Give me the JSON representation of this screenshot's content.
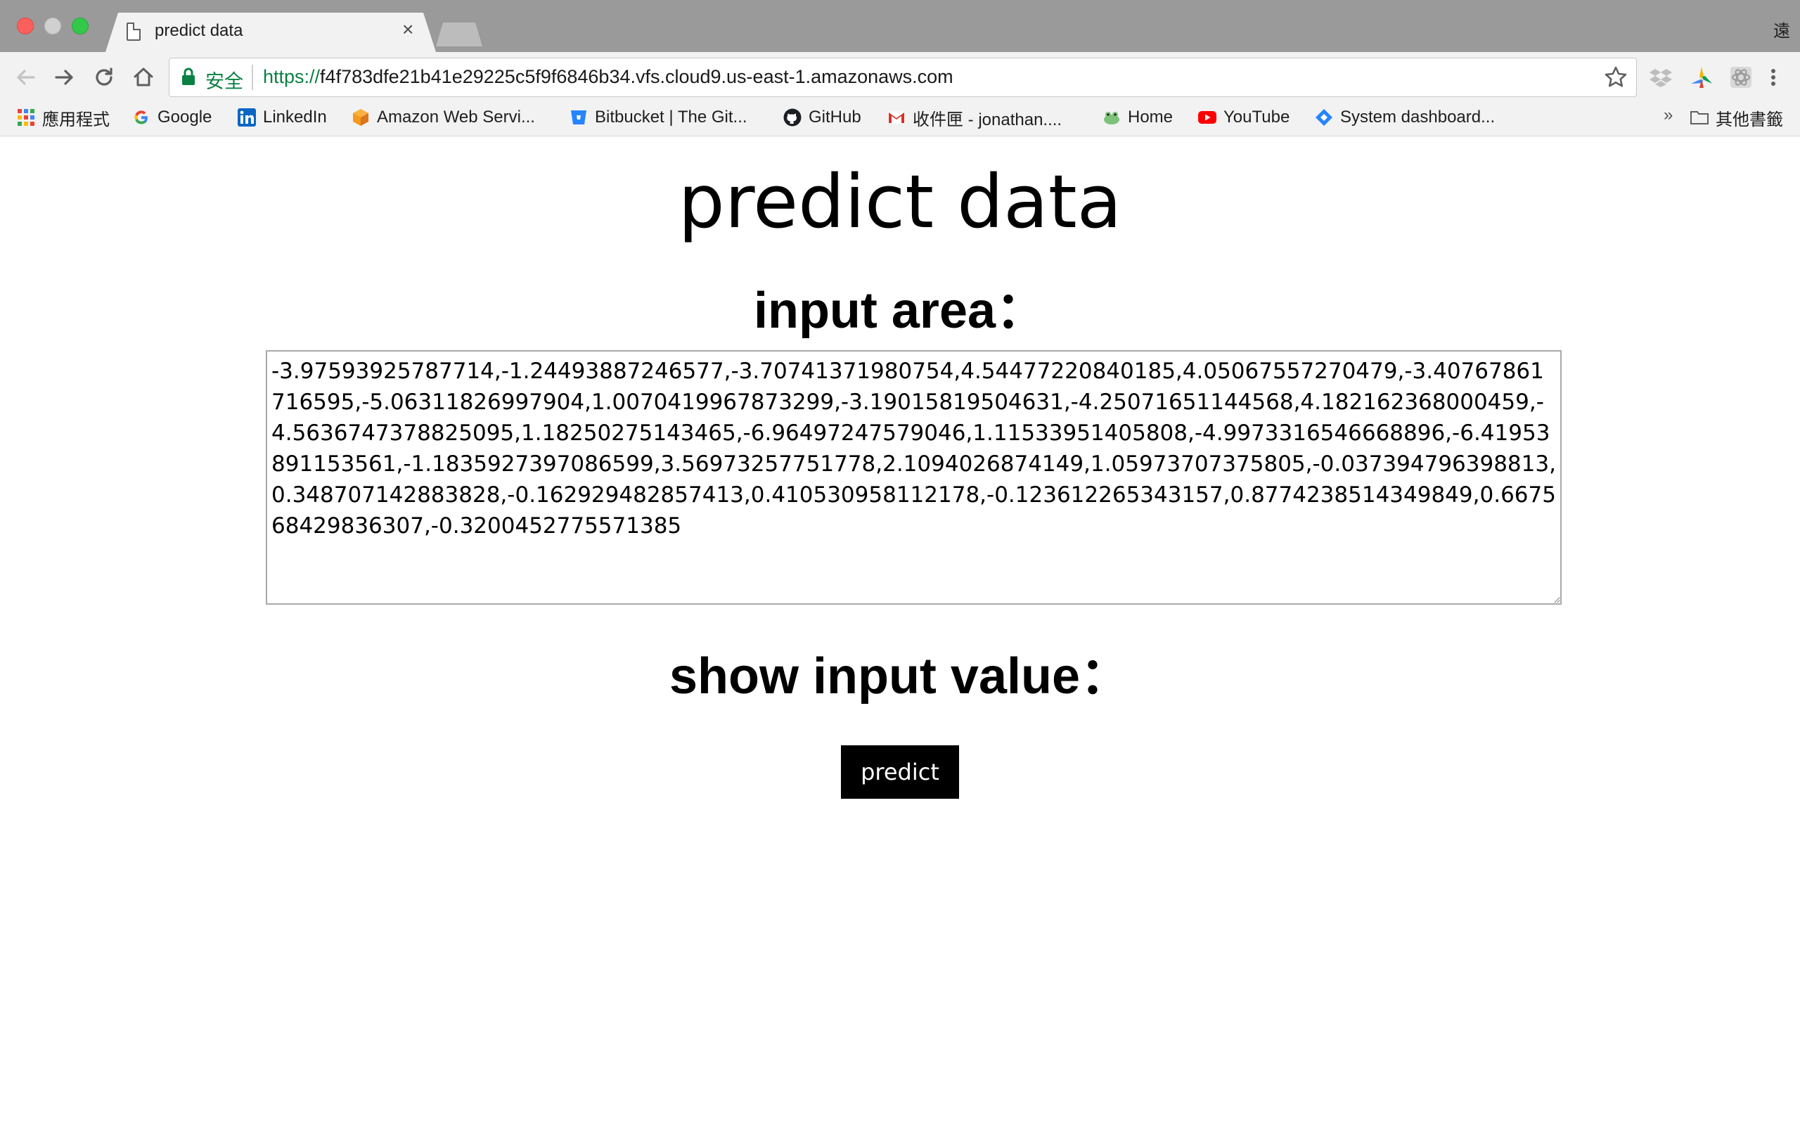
{
  "browser": {
    "tab_title": "predict data",
    "tab_close_glyph": "×",
    "profile_char": "遠",
    "secure_label": "安全",
    "url_scheme": "https://",
    "url_rest": "f4f783dfe21b41e29225c5f9f6846b34.vfs.cloud9.us-east-1.amazonaws.com",
    "bookmarks": [
      {
        "label": "應用程式",
        "icon": "apps-grid-icon"
      },
      {
        "label": "Google",
        "icon": "google-icon"
      },
      {
        "label": "LinkedIn",
        "icon": "linkedin-icon"
      },
      {
        "label": "Amazon Web Servi...",
        "icon": "aws-icon"
      },
      {
        "label": "Bitbucket | The Git...",
        "icon": "bitbucket-icon"
      },
      {
        "label": "GitHub",
        "icon": "github-icon"
      },
      {
        "label": "收件匣 - jonathan....",
        "icon": "gmail-icon"
      },
      {
        "label": "Home",
        "icon": "home-frog-icon"
      },
      {
        "label": "YouTube",
        "icon": "youtube-icon"
      },
      {
        "label": "System dashboard...",
        "icon": "jira-icon"
      }
    ],
    "bookmarks_overflow": "»",
    "other_bookmarks": "其他書籤"
  },
  "page": {
    "title": "predict data",
    "input_heading": "input area：",
    "textarea_value": "-3.97593925787714,-1.24493887246577,-3.70741371980754,4.54477220840185,4.05067557270479,-3.40767861716595,-5.06311826997904,1.0070419967873299,-3.19015819504631,-4.25071651144568,4.182162368000459,-4.5636747378825095,1.18250275143465,-6.96497247579046,1.11533951405808,-4.9973316546668896,-6.41953891153561,-1.1835927397086599,3.56973257751778,2.1094026874149,1.05973707375805,-0.037394796398813,0.348707142883828,-0.162929482857413,0.410530958112178,-0.123612265343157,0.8774238514349849,0.667568429836307,-0.3200452775571385",
    "show_heading": "show input value：",
    "predict_button": "predict"
  },
  "colors": {
    "titlebar": "#9a9a9a",
    "toolbar": "#f2f2f2",
    "secure_green": "#0b8043",
    "button_bg": "#000000",
    "button_text": "#ffffff"
  }
}
